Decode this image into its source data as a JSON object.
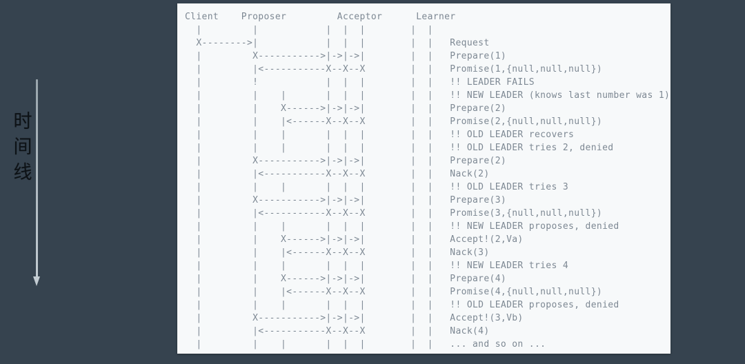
{
  "background_color": "#36434f",
  "panel_color": "#f7f9fa",
  "text_color": "#7d8893",
  "annotation": {
    "label": "时\n间\n线",
    "arrow_name": "downward-arrow",
    "arrow_color": "#c3ccd2"
  },
  "diagram": {
    "type": "ascii-sequence-diagram",
    "columns": [
      "Client",
      "Proposer",
      "Acceptor",
      "Learner"
    ],
    "acceptor_lanes": 3,
    "learner_lanes": 2,
    "header_line": "Client     Proposer      Acceptor     Learner",
    "messages": [
      "Request",
      "Prepare(1)",
      "Promise(1,{null,null,null})",
      "!! LEADER FAILS",
      "!! NEW LEADER (knows last number was 1)",
      "Prepare(2)",
      "Promise(2,{null,null,null})",
      "!! OLD LEADER recovers",
      "!! OLD LEADER tries 2, denied",
      "Prepare(2)",
      "Nack(2)",
      "!! OLD LEADER tries 3",
      "Prepare(3)",
      "Promise(3,{null,null,null})",
      "!! NEW LEADER proposes, denied",
      "Accept!(2,Va)",
      "Nack(3)",
      "!! NEW LEADER tries 4",
      "Prepare(4)",
      "Promise(4,{null,null,null})",
      "!! OLD LEADER proposes, denied",
      "Accept!(3,Vb)",
      "Nack(4)",
      "... and so on ..."
    ],
    "lines": [
      "Client    Proposer       Acceptor     Learner",
      "  |         |          |  |  |       |  |",
      "  X-------->|          |  |  |       |  |   Request",
      "  |         X--------->|->|->|       |  |   Prepare(1)",
      "  |         |<---------X--X--X       |  |   Promise(1,{null,null,null})",
      "  |         !          |  |  |       |  |   !! LEADER FAILS",
      "  |         |   |      |  |  |       |  |   !! NEW LEADER (knows last number was 1)",
      "  |         |   X----->|->|->|       |  |   Prepare(2)",
      "  |         |   |<-----X--X--X       |  |   Promise(2,{null,null,null})",
      "  |         |   |      |  |  |       |  |   !! OLD LEADER recovers",
      "  |         |   |      |  |  |       |  |   !! OLD LEADER tries 2, denied",
      "  |         X--------->|->|->|       |  |   Prepare(2)",
      "  |         |<---------X--X--X       |  |   Nack(2)",
      "  |         |   |      |  |  |       |  |   !! OLD LEADER tries 3",
      "  |         X--------->|->|->|       |  |   Prepare(3)",
      "  |         |<---------X--X--X       |  |   Promise(3,{null,null,null})",
      "  |         |   |      |  |  |       |  |   !! NEW LEADER proposes, denied",
      "  |         |   X----->|->|->|       |  |   Accept!(2,Va)",
      "  |         |   |<-----X--X--X       |  |   Nack(3)",
      "  |         |   |      |  |  |       |  |   !! NEW LEADER tries 4",
      "  |         |   X----->|->|->|       |  |   Prepare(4)",
      "  |         |   |<-----X--X--X       |  |   Promise(4,{null,null,null})",
      "  |         |   |      |  |  |       |  |   !! OLD LEADER proposes, denied",
      "  |         X--------->|->|->|       |  |   Accept!(3,Vb)",
      "  |         |<---------X--X--X       |  |   Nack(4)",
      "  |         |   |      |  |  |       |  |   ... and so on ..."
    ],
    "ascii": "Client    Proposer         Acceptor      Learner\n  |         |            |  |  |        |  |\n  X-------->|            |  |  |        |  |   Request\n  |         X----------->|->|->|        |  |   Prepare(1)\n  |         |<-----------X--X--X        |  |   Promise(1,{null,null,null})\n  |         !            |  |  |        |  |   !! LEADER FAILS\n  |         |    |       |  |  |        |  |   !! NEW LEADER (knows last number was 1)\n  |         |    X------>|->|->|        |  |   Prepare(2)\n  |         |    |<------X--X--X        |  |   Promise(2,{null,null,null})\n  |         |    |       |  |  |        |  |   !! OLD LEADER recovers\n  |         |    |       |  |  |        |  |   !! OLD LEADER tries 2, denied\n  |         X----------->|->|->|        |  |   Prepare(2)\n  |         |<-----------X--X--X        |  |   Nack(2)\n  |         |    |       |  |  |        |  |   !! OLD LEADER tries 3\n  |         X----------->|->|->|        |  |   Prepare(3)\n  |         |<-----------X--X--X        |  |   Promise(3,{null,null,null})\n  |         |    |       |  |  |        |  |   !! NEW LEADER proposes, denied\n  |         |    X------>|->|->|        |  |   Accept!(2,Va)\n  |         |    |<------X--X--X        |  |   Nack(3)\n  |         |    |       |  |  |        |  |   !! NEW LEADER tries 4\n  |         |    X------>|->|->|        |  |   Prepare(4)\n  |         |    |<------X--X--X        |  |   Promise(4,{null,null,null})\n  |         |    |       |  |  |        |  |   !! OLD LEADER proposes, denied\n  |         X----------->|->|->|        |  |   Accept!(3,Vb)\n  |         |<-----------X--X--X        |  |   Nack(4)\n  |         |    |       |  |  |        |  |   ... and so on ..."
  }
}
